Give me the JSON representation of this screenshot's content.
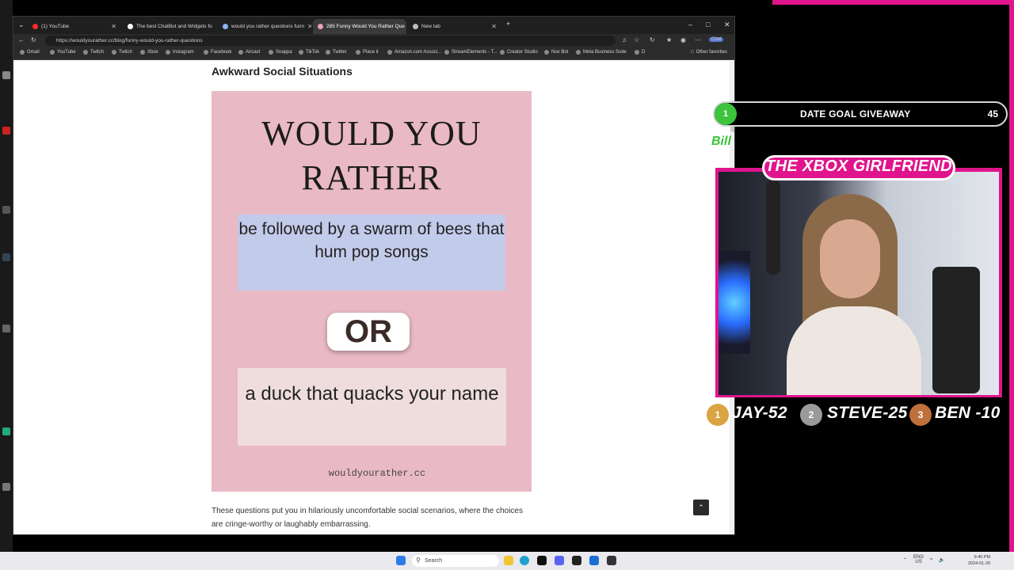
{
  "browser": {
    "tabs": [
      {
        "title": "(1) YouTube",
        "favicon_color": "#ff2a2a"
      },
      {
        "title": "The best ChatBot and Widgets fo",
        "favicon_color": "#ffffff"
      },
      {
        "title": "would you rather questions funn",
        "favicon_color": "#8ab4f8"
      },
      {
        "title": "285 Funny Would You Rather Que",
        "favicon_color": "#e9a1b4"
      },
      {
        "title": "New tab",
        "favicon_color": "#bdbdbd"
      }
    ],
    "new_tab_glyph": "+",
    "url": "https://wouldyourather.cc/blog/funny-would-you-rather-questions",
    "bookmarks": [
      "Gmail",
      "YouTube",
      "Twitch",
      "Twitch",
      "Xbox",
      "Instagram",
      "Facebook",
      "Aircast",
      "Snappa",
      "TikTok",
      "Twitter",
      "Place it",
      "Amazon.com Associ...",
      "StreamElements - T...",
      "Creator Studio",
      "Nox Bot",
      "Meta Business Suite",
      "D"
    ],
    "other_favorites": "Other favorites",
    "profile_label": "Chel"
  },
  "page": {
    "section_title": "Awkward Social Situations",
    "card": {
      "title_line1": "WOULD YOU",
      "title_line2": "RATHER",
      "option_a": "be followed by a swarm of bees that hum pop songs",
      "or_text": "OR",
      "option_b": "a duck that quacks your name",
      "site": "wouldyourather.cc"
    },
    "body": "These questions put you in hilariously uncomfortable social scenarios, where the choices are cringe-worthy or laughably embarrassing."
  },
  "overlay": {
    "goal": {
      "rank": "1",
      "label": "DATE GOAL GIVEAWAY",
      "count": "45",
      "sub": "Bill"
    },
    "streamer_name": "THE XBOX GIRLFRIEND",
    "leaderboard": [
      {
        "rank": "1",
        "name": "JAY-52",
        "color": "#d9a441"
      },
      {
        "rank": "2",
        "name": "STEVE-25",
        "color": "#9a9a9a"
      },
      {
        "rank": "3",
        "name": "BEN -10",
        "color": "#c0703a"
      }
    ]
  },
  "taskbar": {
    "search_placeholder": "Search",
    "tray_lang": "ENG",
    "tray_lang2": "US",
    "time": "9:40 PM",
    "date": "2024-01-26"
  },
  "colors": {
    "stream_pink": "#e0148c",
    "card_pink": "#e9b9c5",
    "option_a_bg": "#c3cbea",
    "option_b_bg": "#efdcdc",
    "goal_green": "#3cc43c"
  }
}
